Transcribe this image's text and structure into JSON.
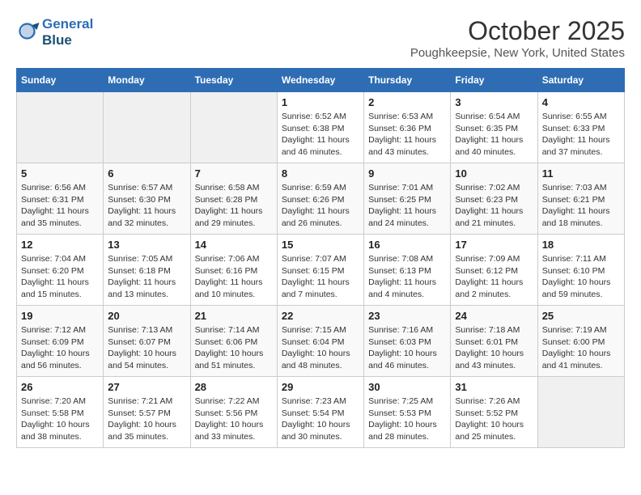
{
  "logo": {
    "line1": "General",
    "line2": "Blue"
  },
  "title": "October 2025",
  "location": "Poughkeepsie, New York, United States",
  "days_of_week": [
    "Sunday",
    "Monday",
    "Tuesday",
    "Wednesday",
    "Thursday",
    "Friday",
    "Saturday"
  ],
  "weeks": [
    [
      {
        "day": "",
        "info": ""
      },
      {
        "day": "",
        "info": ""
      },
      {
        "day": "",
        "info": ""
      },
      {
        "day": "1",
        "info": "Sunrise: 6:52 AM\nSunset: 6:38 PM\nDaylight: 11 hours and 46 minutes."
      },
      {
        "day": "2",
        "info": "Sunrise: 6:53 AM\nSunset: 6:36 PM\nDaylight: 11 hours and 43 minutes."
      },
      {
        "day": "3",
        "info": "Sunrise: 6:54 AM\nSunset: 6:35 PM\nDaylight: 11 hours and 40 minutes."
      },
      {
        "day": "4",
        "info": "Sunrise: 6:55 AM\nSunset: 6:33 PM\nDaylight: 11 hours and 37 minutes."
      }
    ],
    [
      {
        "day": "5",
        "info": "Sunrise: 6:56 AM\nSunset: 6:31 PM\nDaylight: 11 hours and 35 minutes."
      },
      {
        "day": "6",
        "info": "Sunrise: 6:57 AM\nSunset: 6:30 PM\nDaylight: 11 hours and 32 minutes."
      },
      {
        "day": "7",
        "info": "Sunrise: 6:58 AM\nSunset: 6:28 PM\nDaylight: 11 hours and 29 minutes."
      },
      {
        "day": "8",
        "info": "Sunrise: 6:59 AM\nSunset: 6:26 PM\nDaylight: 11 hours and 26 minutes."
      },
      {
        "day": "9",
        "info": "Sunrise: 7:01 AM\nSunset: 6:25 PM\nDaylight: 11 hours and 24 minutes."
      },
      {
        "day": "10",
        "info": "Sunrise: 7:02 AM\nSunset: 6:23 PM\nDaylight: 11 hours and 21 minutes."
      },
      {
        "day": "11",
        "info": "Sunrise: 7:03 AM\nSunset: 6:21 PM\nDaylight: 11 hours and 18 minutes."
      }
    ],
    [
      {
        "day": "12",
        "info": "Sunrise: 7:04 AM\nSunset: 6:20 PM\nDaylight: 11 hours and 15 minutes."
      },
      {
        "day": "13",
        "info": "Sunrise: 7:05 AM\nSunset: 6:18 PM\nDaylight: 11 hours and 13 minutes."
      },
      {
        "day": "14",
        "info": "Sunrise: 7:06 AM\nSunset: 6:16 PM\nDaylight: 11 hours and 10 minutes."
      },
      {
        "day": "15",
        "info": "Sunrise: 7:07 AM\nSunset: 6:15 PM\nDaylight: 11 hours and 7 minutes."
      },
      {
        "day": "16",
        "info": "Sunrise: 7:08 AM\nSunset: 6:13 PM\nDaylight: 11 hours and 4 minutes."
      },
      {
        "day": "17",
        "info": "Sunrise: 7:09 AM\nSunset: 6:12 PM\nDaylight: 11 hours and 2 minutes."
      },
      {
        "day": "18",
        "info": "Sunrise: 7:11 AM\nSunset: 6:10 PM\nDaylight: 10 hours and 59 minutes."
      }
    ],
    [
      {
        "day": "19",
        "info": "Sunrise: 7:12 AM\nSunset: 6:09 PM\nDaylight: 10 hours and 56 minutes."
      },
      {
        "day": "20",
        "info": "Sunrise: 7:13 AM\nSunset: 6:07 PM\nDaylight: 10 hours and 54 minutes."
      },
      {
        "day": "21",
        "info": "Sunrise: 7:14 AM\nSunset: 6:06 PM\nDaylight: 10 hours and 51 minutes."
      },
      {
        "day": "22",
        "info": "Sunrise: 7:15 AM\nSunset: 6:04 PM\nDaylight: 10 hours and 48 minutes."
      },
      {
        "day": "23",
        "info": "Sunrise: 7:16 AM\nSunset: 6:03 PM\nDaylight: 10 hours and 46 minutes."
      },
      {
        "day": "24",
        "info": "Sunrise: 7:18 AM\nSunset: 6:01 PM\nDaylight: 10 hours and 43 minutes."
      },
      {
        "day": "25",
        "info": "Sunrise: 7:19 AM\nSunset: 6:00 PM\nDaylight: 10 hours and 41 minutes."
      }
    ],
    [
      {
        "day": "26",
        "info": "Sunrise: 7:20 AM\nSunset: 5:58 PM\nDaylight: 10 hours and 38 minutes."
      },
      {
        "day": "27",
        "info": "Sunrise: 7:21 AM\nSunset: 5:57 PM\nDaylight: 10 hours and 35 minutes."
      },
      {
        "day": "28",
        "info": "Sunrise: 7:22 AM\nSunset: 5:56 PM\nDaylight: 10 hours and 33 minutes."
      },
      {
        "day": "29",
        "info": "Sunrise: 7:23 AM\nSunset: 5:54 PM\nDaylight: 10 hours and 30 minutes."
      },
      {
        "day": "30",
        "info": "Sunrise: 7:25 AM\nSunset: 5:53 PM\nDaylight: 10 hours and 28 minutes."
      },
      {
        "day": "31",
        "info": "Sunrise: 7:26 AM\nSunset: 5:52 PM\nDaylight: 10 hours and 25 minutes."
      },
      {
        "day": "",
        "info": ""
      }
    ]
  ]
}
